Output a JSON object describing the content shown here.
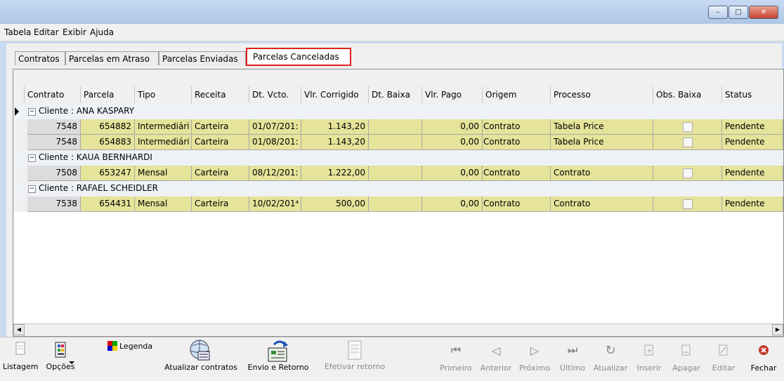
{
  "menu": [
    "Tabela",
    "Editar",
    "Exibir",
    "Ajuda"
  ],
  "tabs": [
    "Contratos",
    "Parcelas em Atraso",
    "Parcelas Enviadas",
    "Parcelas Canceladas"
  ],
  "columns": [
    "Contrato",
    "Parcela",
    "Tipo",
    "Receita",
    "Dt. Vcto.",
    "Vlr. Corrigido",
    "Dt. Baixa",
    "Vlr. Pago",
    "Origem",
    "Processo",
    "Obs. Baixa",
    "Status"
  ],
  "groups": [
    {
      "label": "Cliente : ANA KASPARY",
      "rows": [
        {
          "contrato": "7548",
          "parcela": "654882",
          "tipo": "Intermediári",
          "receita": "Carteira",
          "vcto": "01/07/201:",
          "corrigido": "1.143,20",
          "baixa": "",
          "pago": "0,00",
          "origem": "Contrato",
          "processo": "Tabela Price",
          "status": "Pendente"
        },
        {
          "contrato": "7548",
          "parcela": "654883",
          "tipo": "Intermediári",
          "receita": "Carteira",
          "vcto": "01/08/201:",
          "corrigido": "1.143,20",
          "baixa": "",
          "pago": "0,00",
          "origem": "Contrato",
          "processo": "Tabela Price",
          "status": "Pendente"
        }
      ]
    },
    {
      "label": "Cliente : KAUA BERNHARDI",
      "rows": [
        {
          "contrato": "7508",
          "parcela": "653247",
          "tipo": "Mensal",
          "receita": "Carteira",
          "vcto": "08/12/201:",
          "corrigido": "1.222,00",
          "baixa": "",
          "pago": "0,00",
          "origem": "Contrato",
          "processo": "Contrato",
          "status": "Pendente"
        }
      ]
    },
    {
      "label": "Cliente : RAFAEL SCHEIDLER",
      "rows": [
        {
          "contrato": "7538",
          "parcela": "654431",
          "tipo": "Mensal",
          "receita": "Carteira",
          "vcto": "10/02/201⁴",
          "corrigido": "500,00",
          "baixa": "",
          "pago": "0,00",
          "origem": "Contrato",
          "processo": "Contrato",
          "status": "Pendente"
        }
      ]
    }
  ],
  "toolbar": {
    "listagem": "Listagem",
    "opcoes": "Opções",
    "legenda": "Legenda",
    "atualizar_contratos": "Atualizar contratos",
    "envio_retorno": "Envio e Retorno",
    "efetivar_retorno": "Efetivar retorno",
    "primeiro": "Primeiro",
    "anterior": "Anterior",
    "proximo": "Próximo",
    "ultimo": "Último",
    "atualizar": "Atualizar",
    "inserir": "Inserir",
    "apagar": "Apagar",
    "editar": "Editar",
    "fechar": "Fechar"
  },
  "colors": {
    "row_fill": "#e6e39a",
    "active_tab_border": "#e02020",
    "close_icon": "#c0392b"
  },
  "icons": [
    "minimize-icon",
    "maximize-icon",
    "close-icon",
    "listagem-icon",
    "opcoes-icon",
    "legenda-icon",
    "globe-refresh-icon",
    "envio-retorno-icon",
    "efetivar-icon",
    "first-icon",
    "previous-icon",
    "next-icon",
    "last-icon",
    "refresh-icon",
    "insert-icon",
    "delete-icon",
    "edit-icon",
    "close-circle-icon"
  ]
}
